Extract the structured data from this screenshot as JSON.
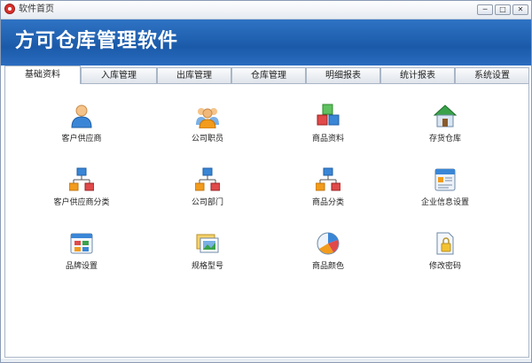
{
  "window": {
    "title": "软件首页"
  },
  "banner": {
    "title": "方可仓库管理软件"
  },
  "tabs": [
    {
      "label": "基础资料"
    },
    {
      "label": "入库管理"
    },
    {
      "label": "出库管理"
    },
    {
      "label": "仓库管理"
    },
    {
      "label": "明细报表"
    },
    {
      "label": "统计报表"
    },
    {
      "label": "系统设置"
    }
  ],
  "items": [
    {
      "label": "客户供应商",
      "icon": "customer-supplier-icon"
    },
    {
      "label": "公司职员",
      "icon": "staff-icon"
    },
    {
      "label": "商品资料",
      "icon": "products-icon"
    },
    {
      "label": "存货仓库",
      "icon": "warehouse-icon"
    },
    {
      "label": "客户供应商分类",
      "icon": "customer-category-icon"
    },
    {
      "label": "公司部门",
      "icon": "department-icon"
    },
    {
      "label": "商品分类",
      "icon": "product-category-icon"
    },
    {
      "label": "企业信息设置",
      "icon": "company-info-icon"
    },
    {
      "label": "品牌设置",
      "icon": "brand-icon"
    },
    {
      "label": "规格型号",
      "icon": "spec-model-icon"
    },
    {
      "label": "商品颜色",
      "icon": "product-color-icon"
    },
    {
      "label": "修改密码",
      "icon": "password-icon"
    }
  ],
  "colors": {
    "banner": "#1b5aa9",
    "accent_orange": "#f29b1c",
    "accent_blue": "#3a86d6"
  }
}
